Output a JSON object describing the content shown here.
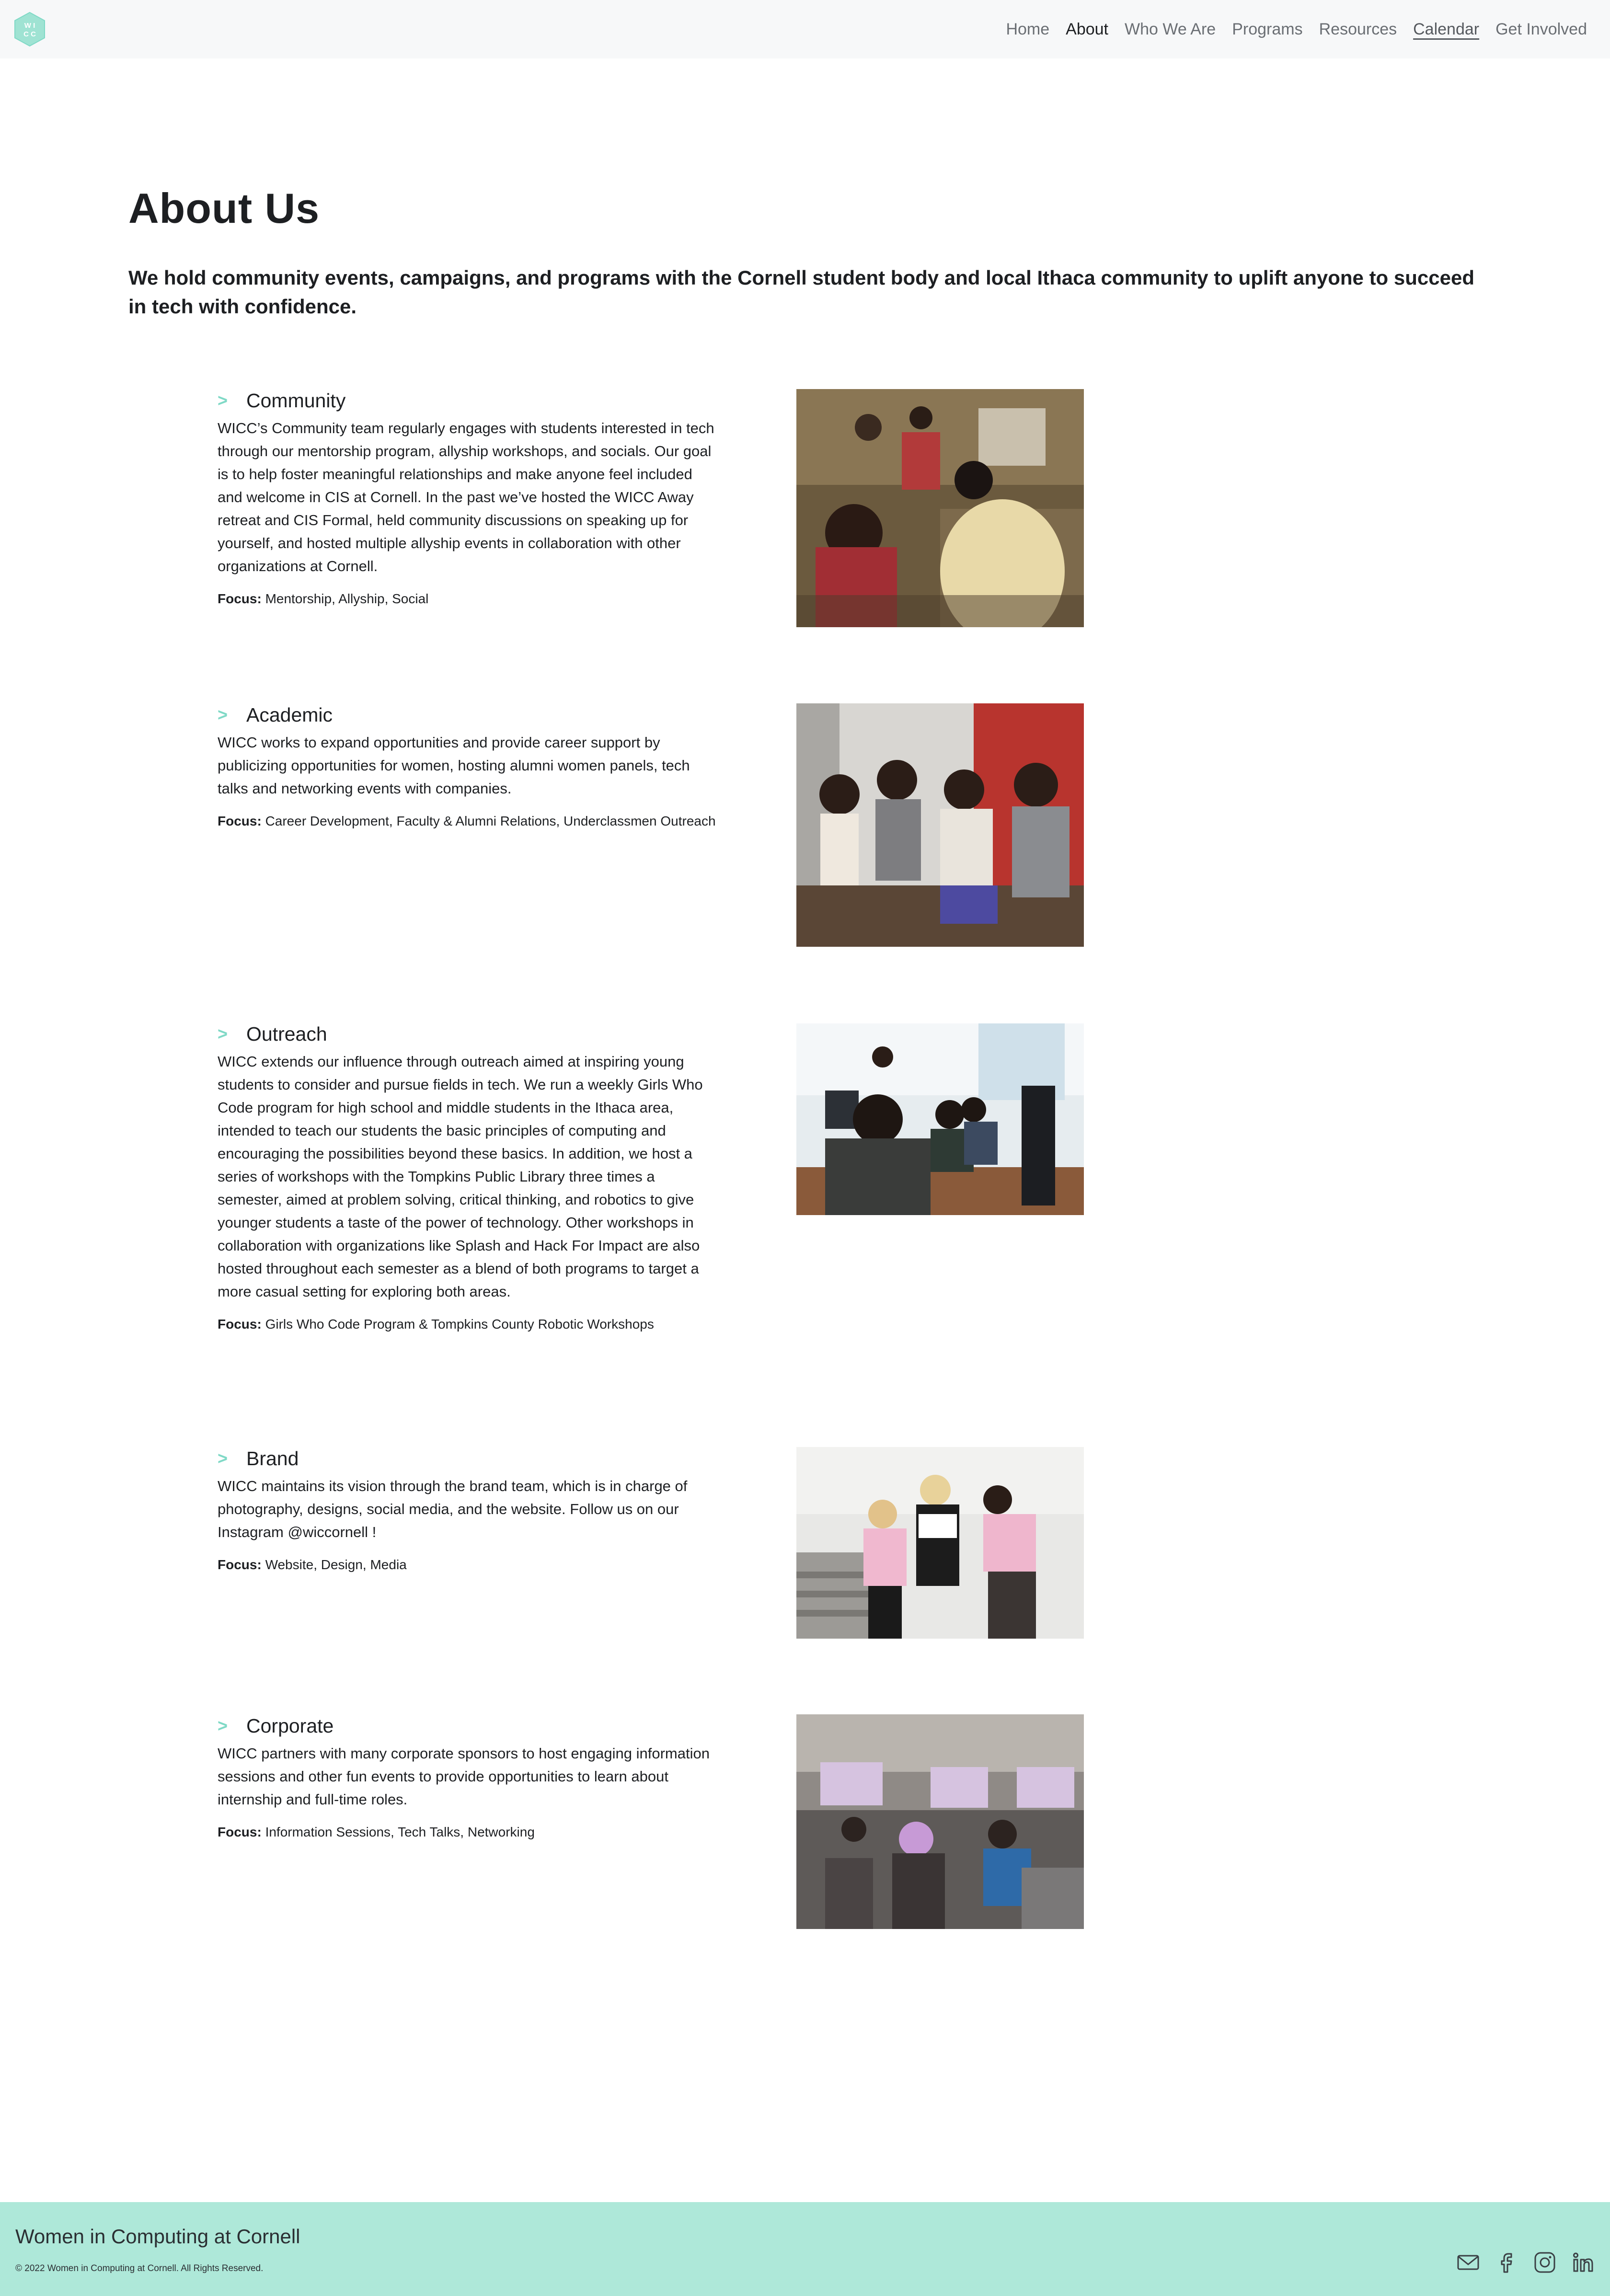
{
  "nav": {
    "logo_text": "WICC",
    "links": [
      {
        "label": "Home"
      },
      {
        "label": "About"
      },
      {
        "label": "Who We Are"
      },
      {
        "label": "Programs"
      },
      {
        "label": "Resources"
      },
      {
        "label": "Calendar"
      },
      {
        "label": "Get Involved"
      }
    ]
  },
  "header": {
    "title": "About Us",
    "intro": "We hold community events, campaigns, and programs with the Cornell student body and local Ithaca community to uplift anyone to succeed in tech with confidence."
  },
  "sections": [
    {
      "chevron": ">",
      "title": "Community",
      "body": "WICC’s Community team regularly engages with students interested in tech through our mentorship program, allyship workshops, and socials. Our goal is to help foster meaningful relationships and make anyone feel included and welcome in CIS at Cornell. In the past we’ve hosted the WICC Away retreat and CIS Formal, held community discussions on speaking up for yourself, and hosted multiple allyship events in collaboration with other organizations at Cornell.",
      "focus_label": "Focus:",
      "focus": "Mentorship, Allyship, Social"
    },
    {
      "chevron": ">",
      "title": "Academic",
      "body": "WICC works to expand opportunities and provide career support by publicizing opportunities for women, hosting alumni women panels, tech talks and networking events with companies.",
      "focus_label": "Focus:",
      "focus": "Career Development, Faculty & Alumni Relations, Underclassmen Outreach"
    },
    {
      "chevron": ">",
      "title": "Outreach",
      "body": "WICC extends our influence through outreach aimed at inspiring young students to consider and pursue fields in tech. We run a weekly Girls Who Code program for high school and middle students in the Ithaca area, intended to teach our students the basic principles of computing and encouraging the possibilities beyond these basics. In addition, we host a series of workshops with the Tompkins Public Library three times a semester, aimed at problem solving, critical thinking, and robotics to give younger students a taste of the power of technology. Other workshops in collaboration with organizations like Splash and Hack For Impact are also hosted throughout each semester as a blend of both programs to target a more casual setting for exploring both areas.",
      "focus_label": "Focus:",
      "focus": "Girls Who Code Program & Tompkins County Robotic Workshops"
    },
    {
      "chevron": ">",
      "title": "Brand",
      "body": "WICC maintains its vision through the brand team, which is in charge of photography, designs, social media, and the website. Follow us on our Instagram",
      "handle": "@wiccornell",
      "body_end": " !",
      "focus_label": "Focus:",
      "focus": "Website, Design, Media"
    },
    {
      "chevron": ">",
      "title": "Corporate",
      "body": "WICC partners with many corporate sponsors to host engaging information sessions and other fun events to provide opportunities to learn about internship and full-time roles.",
      "focus_label": "Focus:",
      "focus": "Information Sessions, Tech Talks, Networking"
    }
  ],
  "footer": {
    "title": "Women in Computing at Cornell",
    "copyright": "© 2022 Women in Computing at Cornell. All Rights Reserved.",
    "social": [
      "mail-icon",
      "facebook-icon",
      "instagram-icon",
      "linkedin-icon"
    ]
  },
  "colors": {
    "accent": "#7fd9c6",
    "footer_bg": "#aee8d9",
    "nav_bg": "#f7f8f9",
    "text": "#1d1f22"
  }
}
